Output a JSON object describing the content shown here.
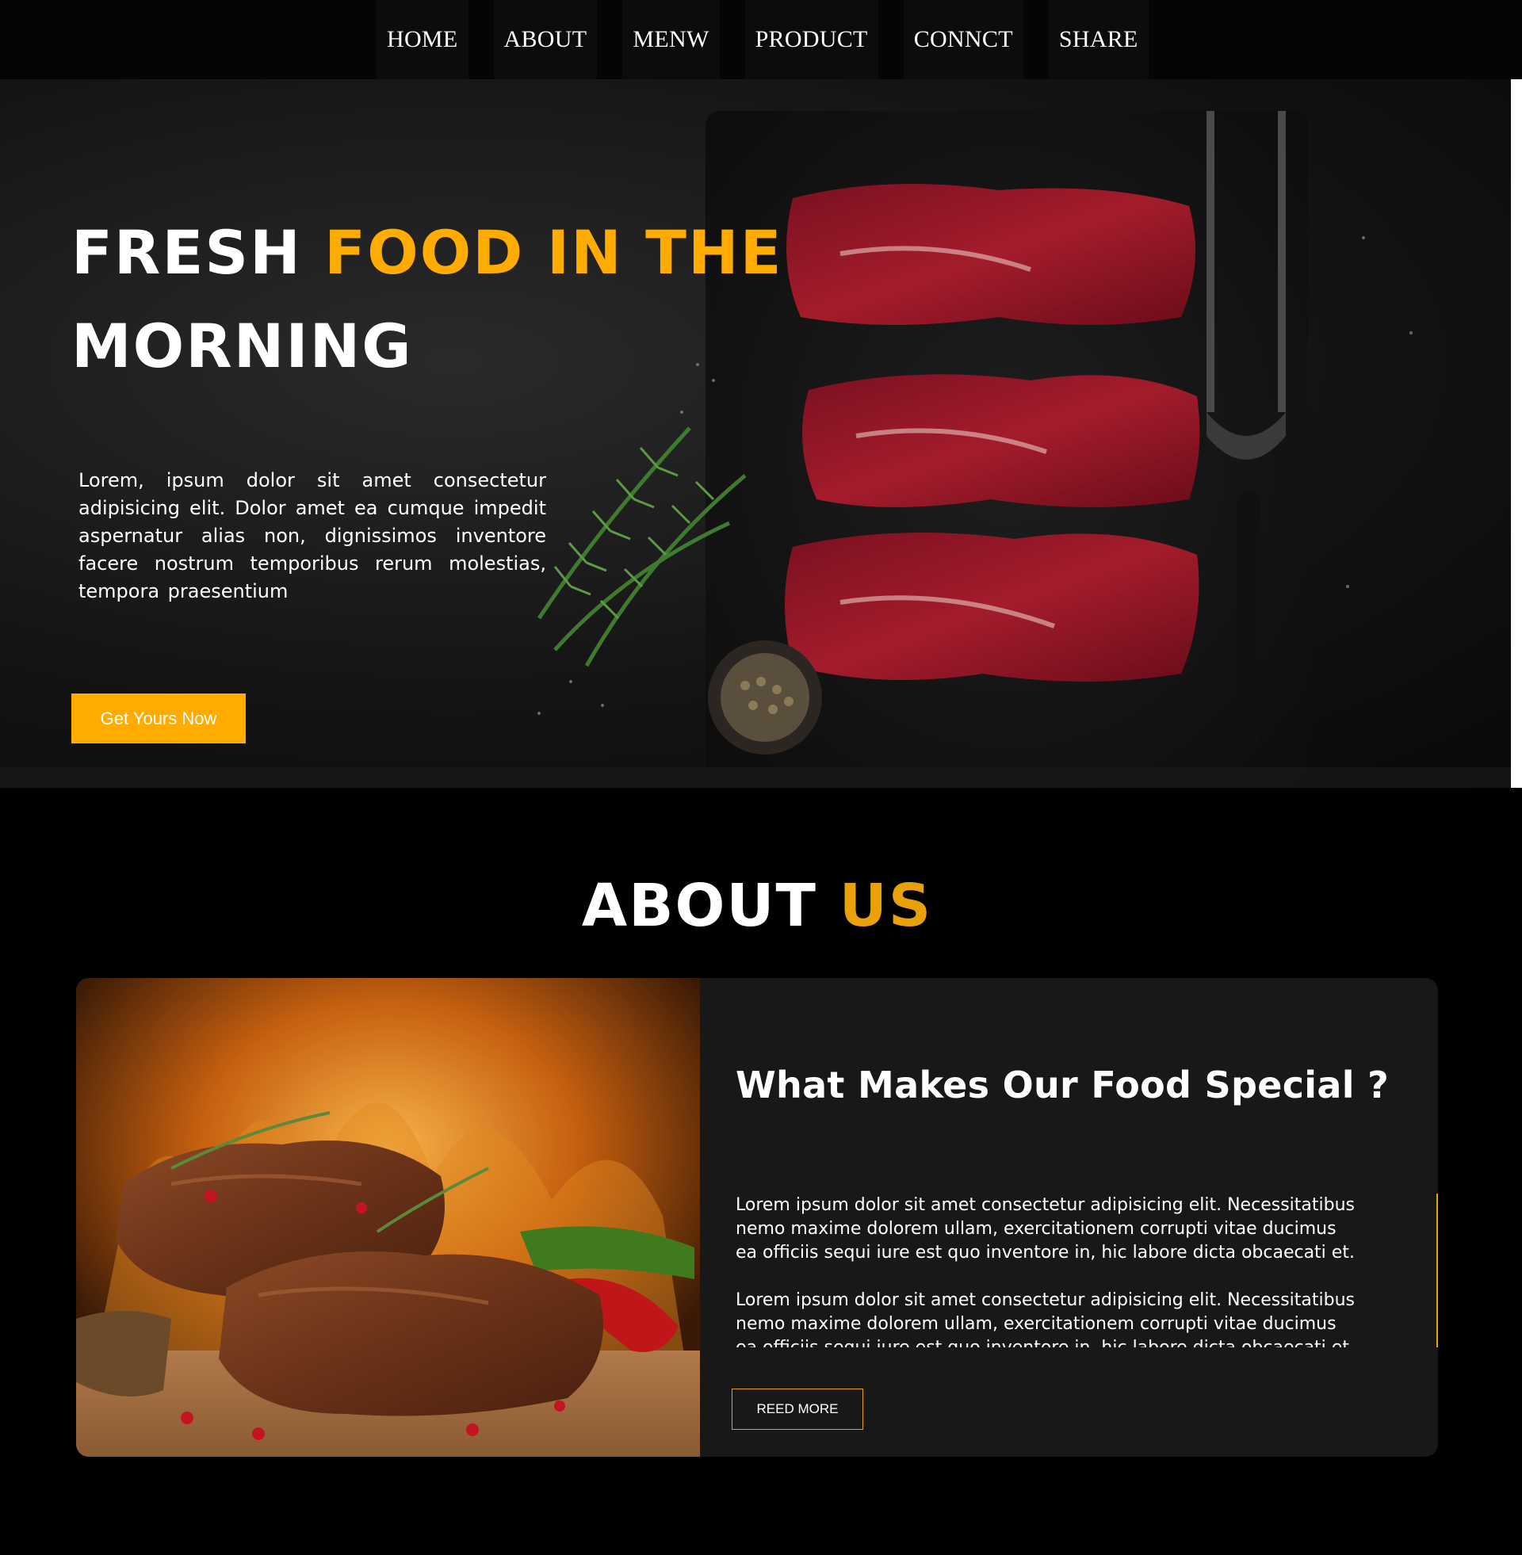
{
  "nav": {
    "items": [
      {
        "label": "HOME"
      },
      {
        "label": "ABOUT"
      },
      {
        "label": "MENW"
      },
      {
        "label": "PRODUCT"
      },
      {
        "label": "CONNCT"
      },
      {
        "label": "SHARE"
      }
    ]
  },
  "hero": {
    "title_part1": "FRESH ",
    "title_accent": "FOOD IN THE",
    "title_part2": "MORNING",
    "text": "Lorem, ipsum dolor sit amet consectetur adipisicing elit. Dolor amet ea cumque impedit aspernatur alias non, dignissimos inventore facere nostrum temporibus rerum molestias, tempora praesentium",
    "cta_label": "Get Yours Now",
    "accent_color": "#ffab00"
  },
  "about": {
    "title_part1": "ABOUT ",
    "title_accent": "US",
    "card": {
      "heading": "What Makes Our Food Special ?",
      "paragraphs": [
        "Lorem ipsum dolor sit amet consectetur adipisicing elit. Necessitatibus nemo maxime dolorem ullam, exercitationem corrupti vitae ducimus ea officiis sequi iure est quo inventore in, hic labore dicta obcaecati et.",
        "Lorem ipsum dolor sit amet consectetur adipisicing elit. Necessitatibus nemo maxime dolorem ullam, exercitationem corrupti vitae ducimus ea officiis sequi iure est quo inventore in, hic labore dicta obcaecati et."
      ],
      "button_label": "REED MORE"
    },
    "accent_color": "#e8a10a"
  }
}
